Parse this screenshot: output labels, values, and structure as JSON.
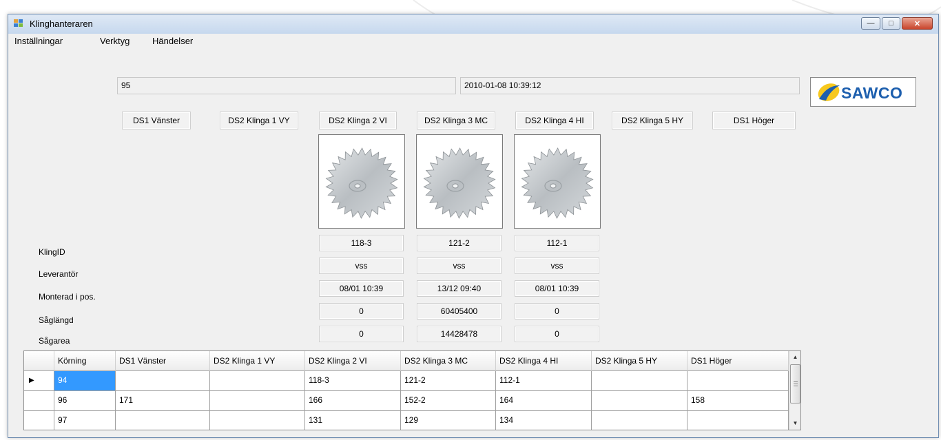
{
  "window": {
    "title": "Klinghanteraren"
  },
  "window_controls": {
    "minimize": "—",
    "maximize": "□",
    "close": "✕"
  },
  "menu": {
    "items": [
      "Inställningar",
      "Verktyg",
      "Händelser"
    ]
  },
  "info": {
    "run_number": "95",
    "datetime": "2010-01-08 10:39:12"
  },
  "logo": {
    "text": "SAWCO",
    "icon": "sawco-swoosh-icon",
    "colors": {
      "blue": "#1d5fae",
      "yellow": "#f7c81e"
    }
  },
  "positions": [
    "DS1 Vänster",
    "DS2 Klinga 1 VY",
    "DS2 Klinga 2 VI",
    "DS2 Klinga 3 MC",
    "DS2 Klinga 4 HI",
    "DS2 Klinga 5 HY",
    "DS1 Höger"
  ],
  "row_labels": [
    "KlingID",
    "Leverantör",
    "Monterad i pos.",
    "Såglängd",
    "Sågarea"
  ],
  "blades": [
    {
      "klingid": "118-3",
      "leverantor": "vss",
      "monterad": "08/01 10:39",
      "saglangd": "0",
      "sagarea": "0"
    },
    {
      "klingid": "121-2",
      "leverantor": "vss",
      "monterad": "13/12 09:40",
      "saglangd": "60405400",
      "sagarea": "14428478"
    },
    {
      "klingid": "112-1",
      "leverantor": "vss",
      "monterad": "08/01 10:39",
      "saglangd": "0",
      "sagarea": "0"
    }
  ],
  "grid": {
    "columns": [
      "Körning",
      "DS1 Vänster",
      "DS2 Klinga 1 VY",
      "DS2 Klinga 2 VI",
      "DS2 Klinga 3 MC",
      "DS2 Klinga 4 HI",
      "DS2 Klinga 5 HY",
      "DS1 Höger"
    ],
    "rows": [
      [
        "94",
        "",
        "",
        "118-3",
        "121-2",
        "112-1",
        "",
        ""
      ],
      [
        "96",
        "171",
        "",
        "166",
        "152-2",
        "164",
        "",
        "158"
      ],
      [
        "97",
        "",
        "",
        "131",
        "129",
        "134",
        "",
        ""
      ]
    ],
    "current_row_marker": "▶",
    "scroll_up": "▲",
    "scroll_down": "▼"
  }
}
